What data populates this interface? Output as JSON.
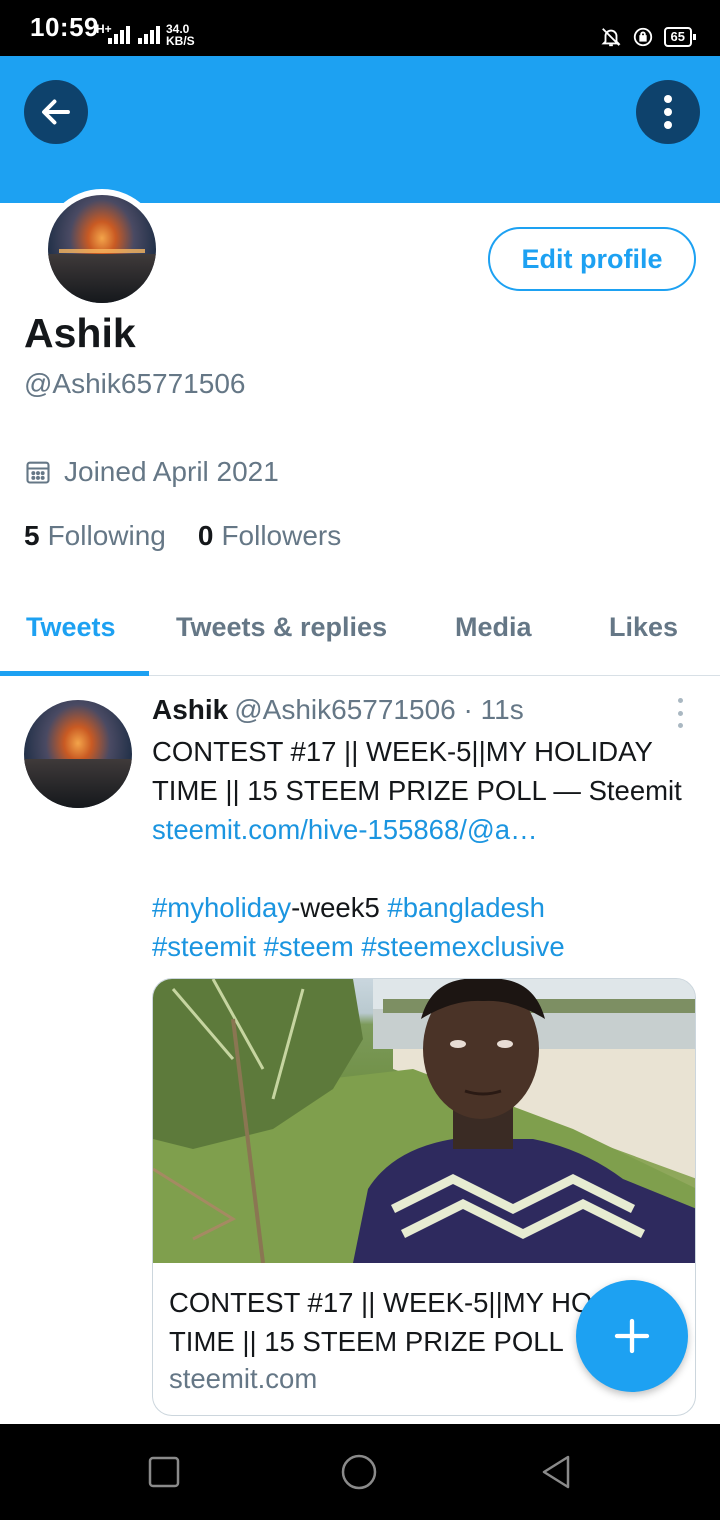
{
  "status_bar": {
    "time": "10:59",
    "network": "H+",
    "speed_value": "34.0",
    "speed_unit": "KB/S",
    "battery": "65"
  },
  "header": {
    "back_icon": "arrow-left-icon",
    "more_icon": "more-vertical-icon",
    "banner_color": "#1da1f2"
  },
  "profile": {
    "edit_label": "Edit profile",
    "name": "Ashik",
    "handle": "@Ashik65771506",
    "joined": "Joined April 2021",
    "following_count": "5",
    "following_label": "Following",
    "followers_count": "0",
    "followers_label": "Followers"
  },
  "tabs": [
    {
      "label": "Tweets",
      "active": true
    },
    {
      "label": "Tweets & replies",
      "active": false
    },
    {
      "label": "Media",
      "active": false
    },
    {
      "label": "Likes",
      "active": false
    }
  ],
  "tweet": {
    "author": "Ashik",
    "handle": "@Ashik65771506",
    "separator": "·",
    "time": "11s",
    "text_line1": "CONTEST #17 || WEEK-5||MY HOLIDAY",
    "text_line2": "TIME || 15 STEEM PRIZE POLL — Steemit",
    "link": "steemit.com/hive-155868/@a…",
    "hashtag1": "#myholiday",
    "hashtag1_suffix": "-week5",
    "hashtag2": "#bangladesh",
    "hashtag3": "#steemit",
    "hashtag4": "#steem",
    "hashtag5": "#steemexclusive",
    "card": {
      "title_line1": "CONTEST #17 || WEEK-5||MY HO",
      "title_line2": "TIME || 15 STEEM PRIZE POLL",
      "domain": "steemit.com"
    }
  },
  "fab": {
    "icon": "plus-icon"
  },
  "accent_color": "#1da1f2"
}
